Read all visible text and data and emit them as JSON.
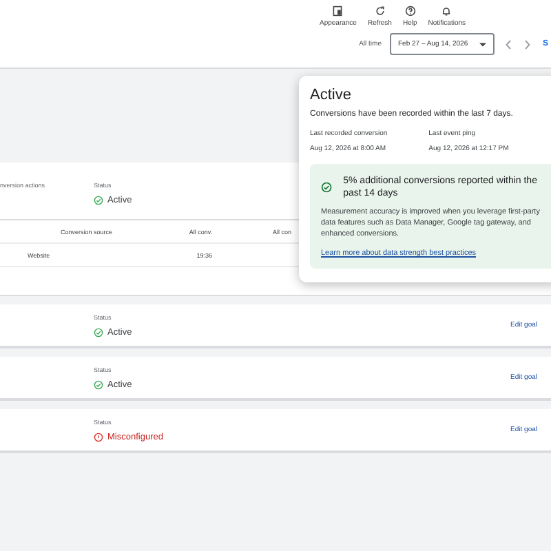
{
  "toolbar": [
    {
      "label": "Appearance",
      "kind": "appearance"
    },
    {
      "label": "Refresh",
      "kind": "refresh"
    },
    {
      "label": "Help",
      "kind": "help"
    },
    {
      "label": "Notifications",
      "kind": "bell"
    }
  ],
  "date_range": {
    "label": "All time",
    "value": "Feb 27 – Aug 14, 2026",
    "next_label": "S"
  },
  "summary": {
    "label": "nversion actions",
    "status_label": "Status",
    "status": "Active",
    "kind": "active",
    "table": {
      "columns": [
        "Conversion source",
        "All conv.",
        "All con"
      ],
      "rows": [
        [
          "Website",
          "19:36",
          ""
        ]
      ]
    }
  },
  "goals": [
    {
      "status_label": "Status",
      "status": "Active",
      "kind": "active",
      "action": "Edit goal"
    },
    {
      "status_label": "Status",
      "status": "Active",
      "kind": "active",
      "action": "Edit goal"
    },
    {
      "status_label": "Status",
      "status": "Misconfigured",
      "kind": "error",
      "action": "Edit goal"
    }
  ],
  "popover": {
    "title": "Active",
    "description": "Conversions have been recorded within the last 7 days.",
    "facts": [
      {
        "label": "Last recorded conversion",
        "value": "Aug 12, 2026 at 8:00 AM"
      },
      {
        "label": "Last event ping",
        "value": "Aug 12, 2026 at 12:17 PM"
      }
    ],
    "notice": {
      "title": "5% additional conversions reported within the past 14 days",
      "body": "Measurement accuracy is improved when you leverage first-party data features such as Data Manager, Google tag gateway, and enhanced conversions.",
      "link": "Learn more about data strength best practices"
    }
  }
}
